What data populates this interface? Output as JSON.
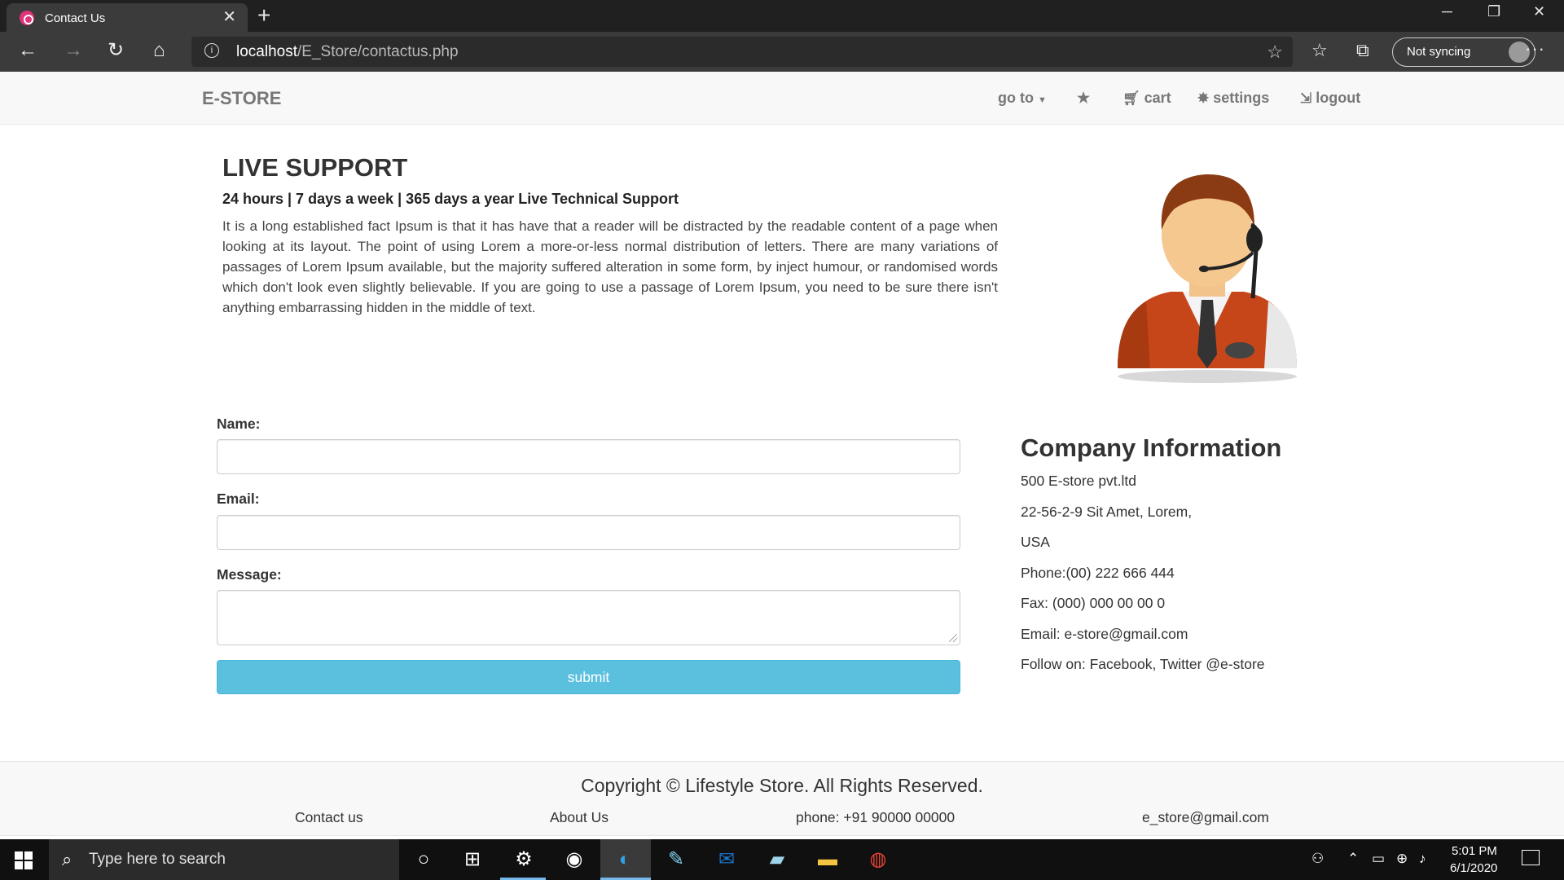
{
  "browser": {
    "tab_title": "Contact Us",
    "url_host": "localhost",
    "url_path": "/E_Store/contactus.php",
    "sync_label": "Not syncing"
  },
  "navbar": {
    "brand": "E-STORE",
    "goto_label": "go to",
    "star_icon": "★",
    "cart_label": "cart",
    "settings_label": "settings",
    "logout_label": "logout"
  },
  "live_support": {
    "title": "LIVE SUPPORT",
    "subtitle": "24 hours | 7 days a week | 365 days a year Live Technical Support",
    "paragraph": "It is a long established fact Ipsum is that it has have that a reader will be distracted by the readable content of a page when looking at its layout. The point of using Lorem a more-or-less normal distribution of letters. There are many variations of passages of Lorem Ipsum available, but the majority suffered alteration in some form, by inject humour, or randomised words which don't look even slightly believable. If you are going to use a passage of Lorem Ipsum, you need to be sure there isn't anything embarrassing hidden in the middle of text."
  },
  "form": {
    "name_label": "Name:",
    "name_value": "",
    "email_label": "Email:",
    "email_value": "",
    "message_label": "Message:",
    "message_value": "",
    "submit_label": "submit"
  },
  "company": {
    "title": "Company Information",
    "lines": [
      "500 E-store pvt.ltd",
      "22-56-2-9 Sit Amet, Lorem,",
      "USA",
      "Phone:(00) 222 666 444",
      "Fax: (000) 000 00 00 0",
      "Email: e-store@gmail.com",
      "Follow on: Facebook, Twitter @e-store"
    ]
  },
  "footer": {
    "copyright": "Copyright © Lifestyle Store. All Rights Reserved.",
    "contact": "Contact us",
    "about": "About Us",
    "phone": "phone: +91 90000 00000",
    "email": "e_store@gmail.com"
  },
  "taskbar": {
    "search_placeholder": "Type here to search",
    "time": "5:01 PM",
    "date": "6/1/2020"
  },
  "colors": {
    "submit": "#5bc0de",
    "navbar_bg": "#f8f8f8",
    "browser_dark": "#202020"
  }
}
